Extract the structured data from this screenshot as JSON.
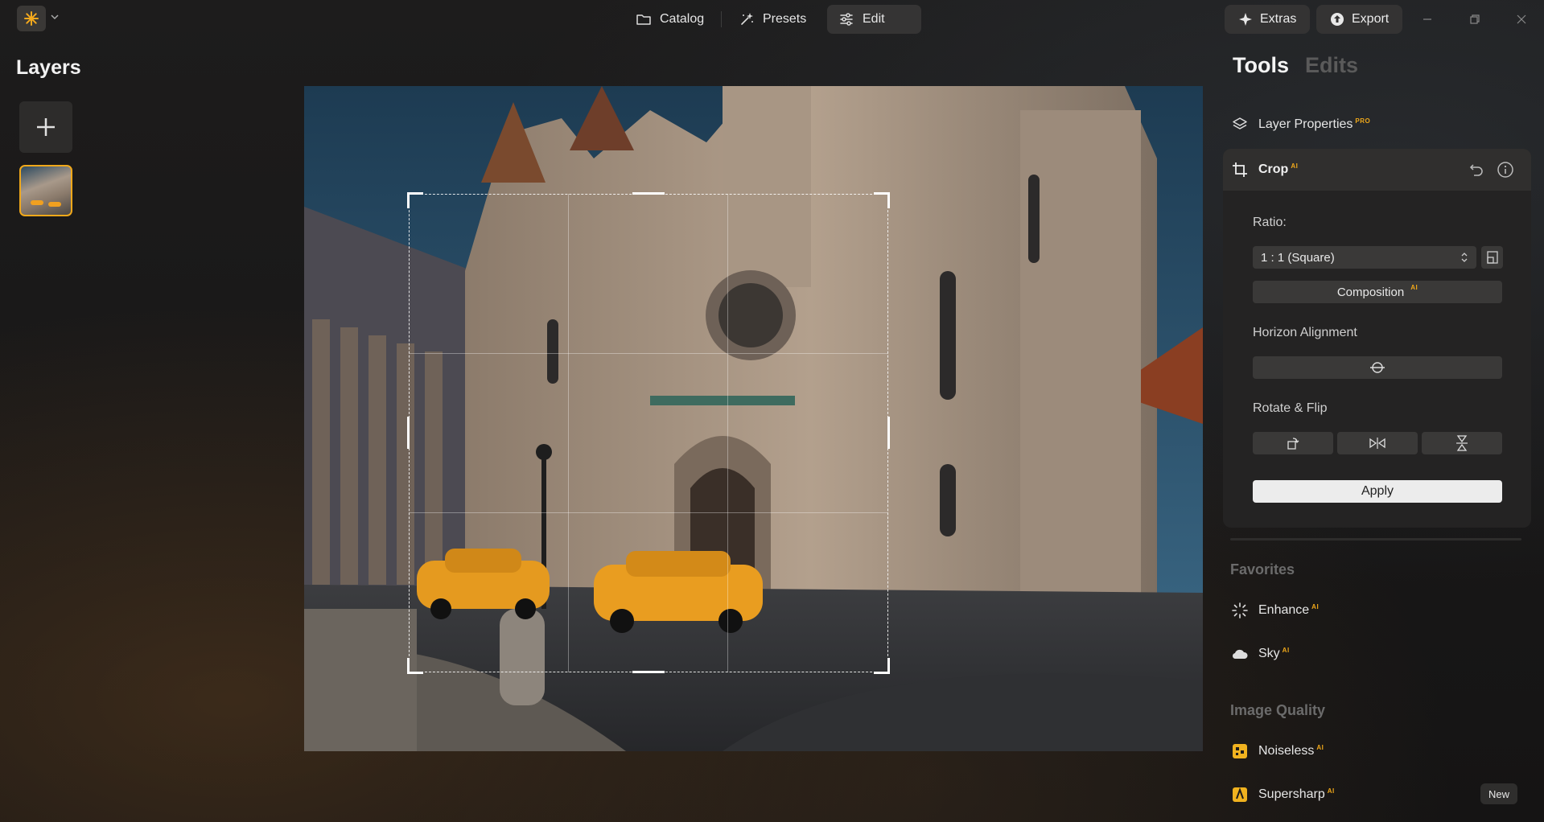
{
  "topbar": {
    "app_icon": "sun-logo-icon",
    "nav": [
      {
        "label": "Catalog",
        "icon": "folder-icon",
        "active": false
      },
      {
        "label": "Presets",
        "icon": "sparkle-wand-icon",
        "active": false
      },
      {
        "label": "Edit",
        "icon": "sliders-icon",
        "active": true
      }
    ],
    "extras_label": "Extras",
    "export_label": "Export"
  },
  "layers": {
    "title": "Layers"
  },
  "panel": {
    "tab_tools": "Tools",
    "tab_edits": "Edits",
    "layer_properties": {
      "label": "Layer Properties",
      "badge": "PRO"
    },
    "crop": {
      "title": "Crop",
      "badge": "AI",
      "ratio_label": "Ratio:",
      "ratio_value": "1 : 1 (Square)",
      "composition_label": "Composition",
      "composition_badge": "AI",
      "horizon_label": "Horizon Alignment",
      "rotate_label": "Rotate & Flip",
      "apply_label": "Apply"
    },
    "favorites": {
      "title": "Favorites",
      "items": [
        {
          "label": "Enhance",
          "badge": "AI",
          "icon": "enhance-icon"
        },
        {
          "label": "Sky",
          "badge": "AI",
          "icon": "cloud-icon"
        }
      ]
    },
    "image_quality": {
      "title": "Image Quality",
      "items": [
        {
          "label": "Noiseless",
          "badge": "AI",
          "icon": "noiseless-icon"
        },
        {
          "label": "Supersharp",
          "badge": "AI",
          "icon": "supersharp-icon"
        }
      ],
      "new_badge": "New"
    }
  },
  "colors": {
    "accent": "#f0a81a",
    "panel_bg": "#242323",
    "button_bg": "#3a3938"
  }
}
